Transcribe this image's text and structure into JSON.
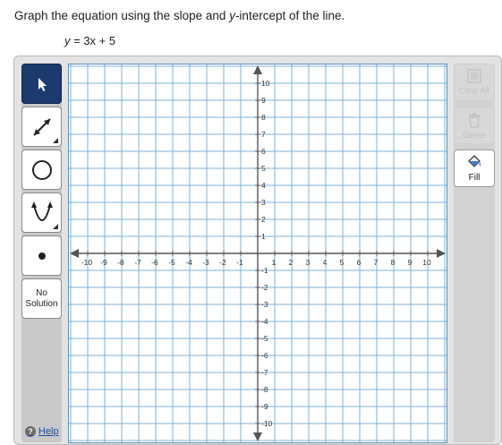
{
  "question": {
    "before": "Graph the equation using the slope and ",
    "var": "y",
    "after": "-intercept of the line."
  },
  "equation": {
    "lhs": "y",
    "rhs": " = 3x + 5"
  },
  "tools": {
    "select_icon": "pointer-arrow-icon",
    "line_icon": "line-segment-icon",
    "circle_icon": "circle-icon",
    "parabola_icon": "parabola-icon",
    "point_icon": "point-icon",
    "no_solution_line1": "No",
    "no_solution_line2": "Solution"
  },
  "help": {
    "icon": "?",
    "label": "Help"
  },
  "right_tools": {
    "clear_all": "Clear All",
    "delete": "Delete",
    "fill": "Fill"
  },
  "graph": {
    "x_range": [
      -10,
      10
    ],
    "y_range": [
      -10,
      10
    ],
    "grid": true,
    "x_tick_labels": [
      "-10",
      "-9",
      "-8",
      "-7",
      "-6",
      "-5",
      "-4",
      "-3",
      "-2",
      "-1",
      "1",
      "2",
      "3",
      "4",
      "5",
      "6",
      "7",
      "8",
      "9",
      "10"
    ],
    "y_tick_labels": [
      "10",
      "9",
      "8",
      "7",
      "6",
      "5",
      "4",
      "3",
      "2",
      "1",
      "-1",
      "-2",
      "-3",
      "-4",
      "-5",
      "-6",
      "-7",
      "-8",
      "-9",
      "-10"
    ],
    "colors": {
      "grid": "#7fb1d6",
      "border": "#5d8fb8",
      "axis": "#555555",
      "selected_tool": "#1d3a6e"
    }
  }
}
